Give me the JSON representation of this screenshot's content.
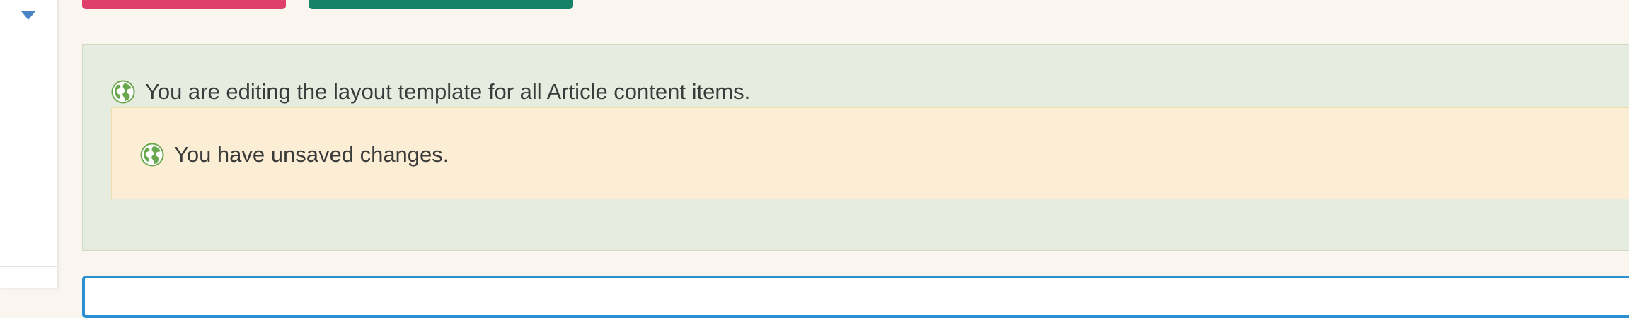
{
  "colors": {
    "page_bg": "#faf5ef",
    "danger_button": "#df3f6b",
    "success_button": "#168369",
    "info_notice_bg": "#e6ecdf",
    "warning_notice_bg": "#fbeed5",
    "editor_border": "#2c8fd1",
    "caret": "#4a86c7",
    "globe": "#6aa84f"
  },
  "sidebar": {
    "toggle_icon": "caret-down-icon"
  },
  "toolbar": {
    "buttons": [
      {
        "label": "",
        "style": "danger"
      },
      {
        "label": "",
        "style": "success"
      }
    ]
  },
  "notices": {
    "info": {
      "icon": "globe-icon",
      "text": "You are editing the layout template for all Article content items."
    },
    "warning": {
      "icon": "globe-icon",
      "text": "You have unsaved changes."
    }
  }
}
